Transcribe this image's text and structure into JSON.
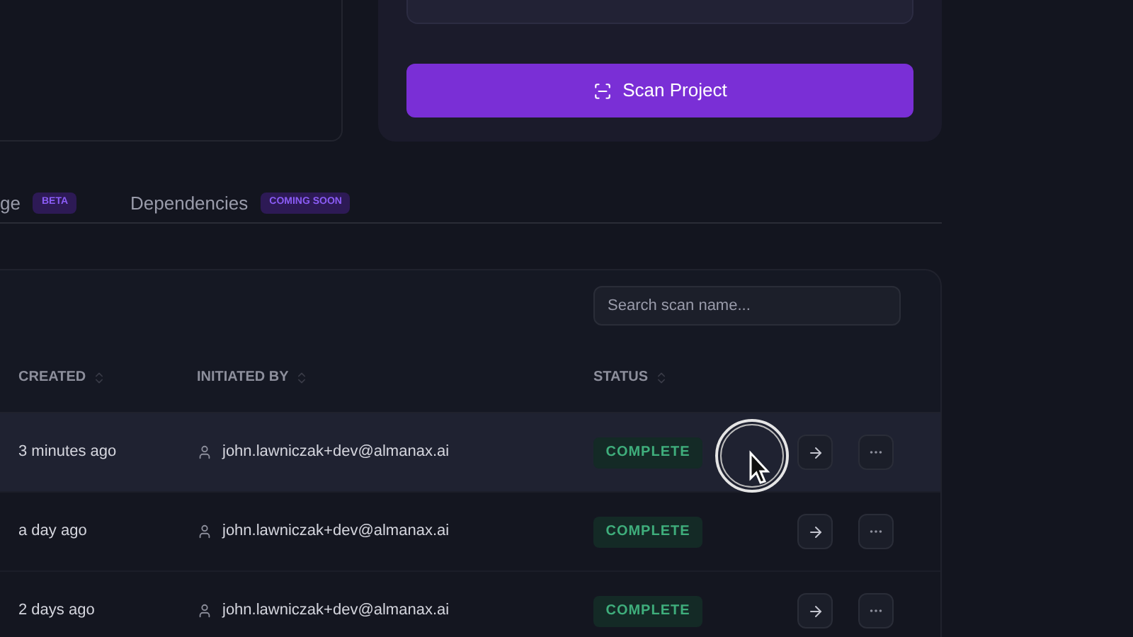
{
  "scan_button": {
    "label": "Scan Project"
  },
  "tabs": [
    {
      "label": "ge",
      "badge": "BETA",
      "selected": false
    },
    {
      "label": "Dependencies",
      "badge": "COMING SOON",
      "selected": false
    }
  ],
  "search": {
    "placeholder": "Search scan name..."
  },
  "table": {
    "columns": [
      "CREATED",
      "INITIATED BY",
      "STATUS"
    ],
    "rows": [
      {
        "created": "3 minutes ago",
        "user": "john.lawniczak+dev@almanax.ai",
        "status": "COMPLETE",
        "hovered": true
      },
      {
        "created": "a day ago",
        "user": "john.lawniczak+dev@almanax.ai",
        "status": "COMPLETE",
        "hovered": false
      },
      {
        "created": "2 days ago",
        "user": "john.lawniczak+dev@almanax.ai",
        "status": "COMPLETE",
        "hovered": false
      }
    ]
  }
}
